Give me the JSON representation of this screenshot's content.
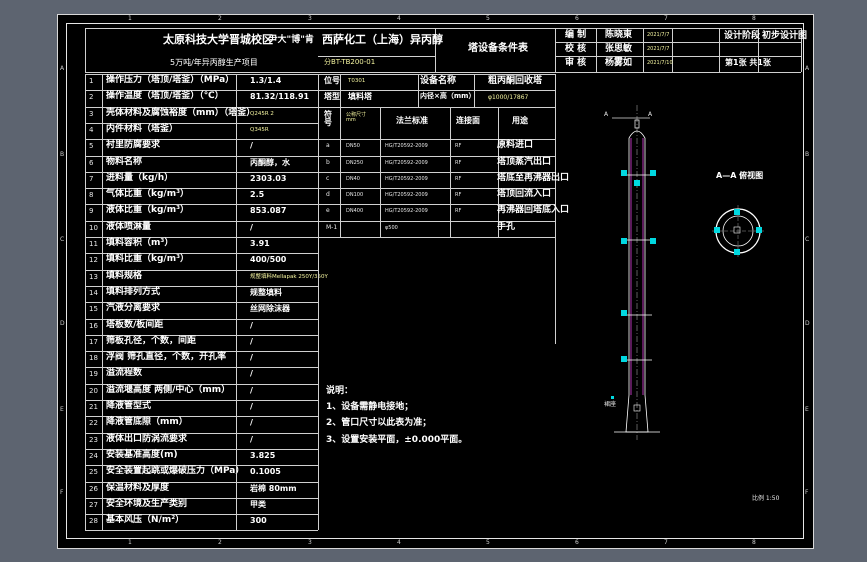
{
  "colors": {
    "background": "#5d6470",
    "paper": "#000000",
    "line": "#d0d0d0",
    "accent": "#00d8e0",
    "dim": "#e040e0"
  },
  "title_block": {
    "school": "太原科技大学晋城校区",
    "company_a": "·  尹大\"博\"肯",
    "company_b": "西萨化工（上海）异丙醇",
    "project": "5万吨/年异丙醇生产项目",
    "code": "分BT-TB200-01",
    "doc_title": "塔设备条件表",
    "roles": [
      "编  制",
      "校  核",
      "审  核"
    ],
    "names": [
      "陈晓東",
      "张思敏",
      "杨雾如"
    ],
    "dates": [
      "2021/7/7",
      "2021/7/7",
      "2021/7/10"
    ],
    "stage_label": "设计阶段",
    "stage_value": "初步设计图",
    "sheet": "第1张  共1张"
  },
  "rows": [
    {
      "no": "1",
      "label": "操作压力（塔顶/塔釜）（MPa）",
      "value": "1.3/1.4"
    },
    {
      "no": "2",
      "label": "操作温度（塔顶/塔釜）（℃）",
      "value": "81.32/118.91"
    },
    {
      "no": "3",
      "label": "壳体材料及腐蚀裕度（mm）（塔釜）",
      "value": "Q245R  2"
    },
    {
      "no": "4",
      "label": "内件材料（塔釜）",
      "value": "Q345R"
    },
    {
      "no": "5",
      "label": "衬里防腐要求",
      "value": "/"
    },
    {
      "no": "6",
      "label": "物料名称",
      "value": "丙酮醇，水"
    },
    {
      "no": "7",
      "label": "进料量（kg/h）",
      "value": "2303.03"
    },
    {
      "no": "8",
      "label": "气体比重（kg/m³）",
      "value": "2.5"
    },
    {
      "no": "9",
      "label": "液体比重（kg/m³）",
      "value": "853.087"
    },
    {
      "no": "10",
      "label": "液体喷淋量",
      "value": "/"
    },
    {
      "no": "11",
      "label": "填料容积（m³）",
      "value": "3.91"
    },
    {
      "no": "12",
      "label": "填料比重（kg/m³）",
      "value": "400/500"
    },
    {
      "no": "13",
      "label": "填料规格",
      "value": "规整填料Mellapak 250Y/350Y"
    },
    {
      "no": "14",
      "label": "填料排列方式",
      "value": "规整填料"
    },
    {
      "no": "15",
      "label": "汽液分离要求",
      "value": "丝网除沫器"
    },
    {
      "no": "16",
      "label": "塔板数/板间距",
      "value": "/"
    },
    {
      "no": "17",
      "label": "筛板孔径，个数，间距",
      "value": "/"
    },
    {
      "no": "18",
      "label": "浮阀 筛孔直径，个数，开孔率",
      "value": "/"
    },
    {
      "no": "19",
      "label": "溢流程数",
      "value": "/"
    },
    {
      "no": "20",
      "label": "溢流堰高度 两侧/中心（mm）",
      "value": "/"
    },
    {
      "no": "21",
      "label": "降液管型式",
      "value": "/"
    },
    {
      "no": "22",
      "label": "降液管底隙（mm）",
      "value": "/"
    },
    {
      "no": "23",
      "label": "液体出口防涡流要求",
      "value": "/"
    },
    {
      "no": "24",
      "label": "安装基准高度(m)",
      "value": "3.825"
    },
    {
      "no": "25",
      "label": "安全装置起跳或爆破压力（MPa）",
      "value": "0.1005"
    },
    {
      "no": "26",
      "label": "保温材料及厚度",
      "value": "岩棉  80mm"
    },
    {
      "no": "27",
      "label": "安全环境及生产类别",
      "value": "甲类"
    },
    {
      "no": "28",
      "label": "基本风压（N/m²）",
      "value": "300"
    }
  ],
  "equipment": {
    "row1": {
      "k1": "位号",
      "v1": "T0301",
      "k2": "设备名称",
      "v2": "粗丙酮回收塔"
    },
    "row2": {
      "k1": "塔型",
      "v1": "填料塔",
      "k2": "内径×高（mm）",
      "v2": "φ1000/17867"
    }
  },
  "nozzles": {
    "headers": [
      "符号",
      "公称尺寸 mm",
      "法兰标准",
      "连接面",
      "用途"
    ],
    "items": [
      {
        "sym": "a",
        "dn": "DN50",
        "std": "HG/T20592-2009",
        "face": "RF",
        "use": "原料进口"
      },
      {
        "sym": "b",
        "dn": "DN250",
        "std": "HG/T20592-2009",
        "face": "RF",
        "use": "塔顶蒸汽出口"
      },
      {
        "sym": "c",
        "dn": "DN40",
        "std": "HG/T20592-2009",
        "face": "RF",
        "use": "塔底至再沸器出口"
      },
      {
        "sym": "d",
        "dn": "DN100",
        "std": "HG/T20592-2009",
        "face": "RF",
        "use": "塔顶回流入口"
      },
      {
        "sym": "e",
        "dn": "DN400",
        "std": "HG/T20592-2009",
        "face": "RF",
        "use": "再沸器回塔底入口"
      },
      {
        "sym": "M-1",
        "dn": "",
        "std": "φ500",
        "face": "",
        "use": "手孔"
      }
    ]
  },
  "notes": {
    "title": "说明：",
    "items": [
      "1、设备需静电接地；",
      "2、管口尺寸以此表为准；",
      "3、设置安装平面，±0.000平面。"
    ]
  },
  "drawing": {
    "section_title": "A—A 俯视图",
    "scale": "比例 1:50",
    "label_a": "A",
    "label_skirt": "裙座"
  },
  "ruler": {
    "cols": [
      "1",
      "2",
      "3",
      "4",
      "5",
      "6",
      "7",
      "8"
    ],
    "rows": [
      "A",
      "B",
      "C",
      "D",
      "E",
      "F"
    ]
  }
}
